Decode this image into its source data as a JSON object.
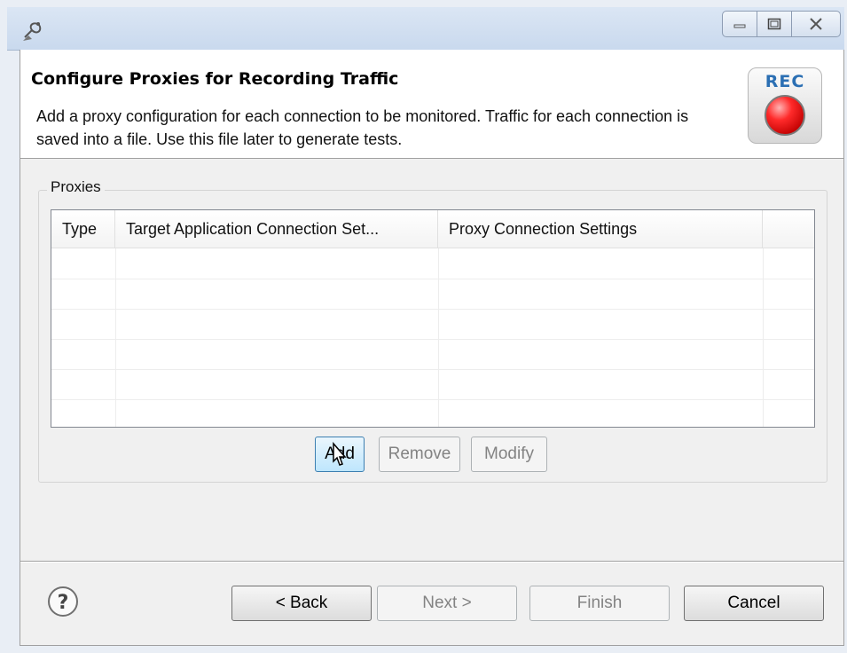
{
  "window": {
    "icon": "satellite-dish-icon",
    "controls": [
      "minimize-icon",
      "maximize-icon",
      "close-icon"
    ]
  },
  "header": {
    "title": "Configure Proxies for Recording Traffic",
    "description": "Add a proxy configuration for each connection to be monitored. Traffic for each connection is saved into a file. Use this file later to generate tests.",
    "badge": "REC",
    "badge_text_color": "#2b6fb3",
    "badge_dot_color": "#ff2a2a"
  },
  "group": {
    "label": "Proxies",
    "table": {
      "columns": [
        "Type",
        "Target Application Connection Set...",
        "Proxy Connection Settings",
        ""
      ],
      "rows": [
        [
          "",
          "",
          "",
          ""
        ],
        [
          "",
          "",
          "",
          ""
        ],
        [
          "",
          "",
          "",
          ""
        ],
        [
          "",
          "",
          "",
          ""
        ],
        [
          "",
          "",
          "",
          ""
        ],
        [
          "",
          "",
          "",
          ""
        ]
      ]
    },
    "buttons": {
      "add": "Add",
      "remove": "Remove",
      "modify": "Modify"
    }
  },
  "footer": {
    "help_icon": "help-question-icon",
    "back": "< Back",
    "next": "Next >",
    "finish": "Finish",
    "cancel": "Cancel"
  }
}
